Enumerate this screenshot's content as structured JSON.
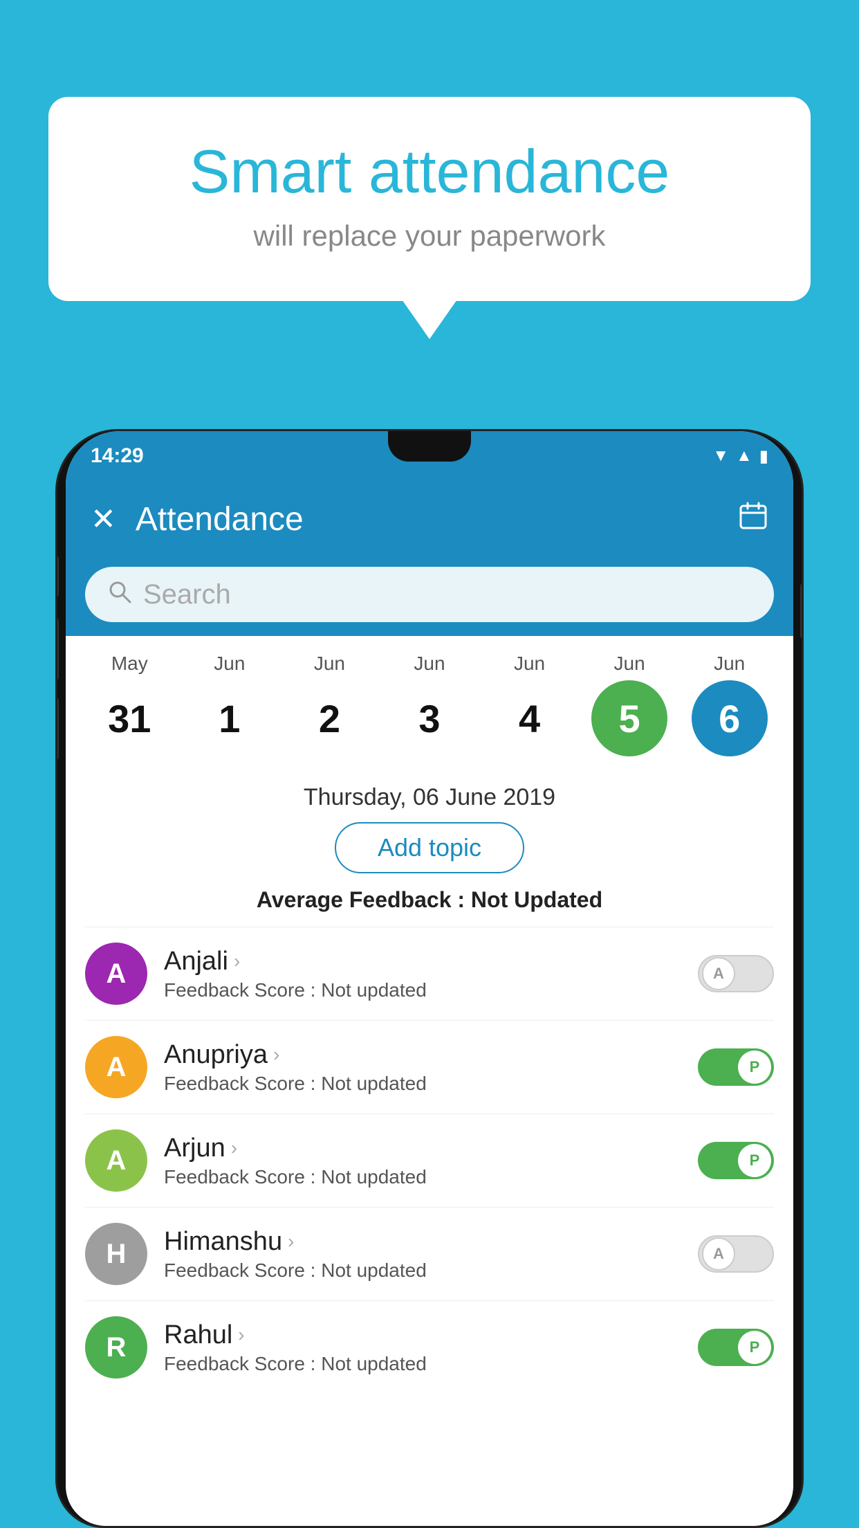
{
  "page": {
    "background_color": "#29B6D8"
  },
  "bubble": {
    "title": "Smart attendance",
    "subtitle": "will replace your paperwork"
  },
  "status_bar": {
    "time": "14:29"
  },
  "app_bar": {
    "title": "Attendance",
    "close_label": "✕",
    "calendar_label": "📅"
  },
  "search": {
    "placeholder": "Search"
  },
  "calendar": {
    "dates": [
      {
        "month": "May",
        "day": "31",
        "style": "normal"
      },
      {
        "month": "Jun",
        "day": "1",
        "style": "normal"
      },
      {
        "month": "Jun",
        "day": "2",
        "style": "normal"
      },
      {
        "month": "Jun",
        "day": "3",
        "style": "normal"
      },
      {
        "month": "Jun",
        "day": "4",
        "style": "normal"
      },
      {
        "month": "Jun",
        "day": "5",
        "style": "today"
      },
      {
        "month": "Jun",
        "day": "6",
        "style": "selected"
      }
    ],
    "selected_date": "Thursday, 06 June 2019"
  },
  "add_topic_label": "Add topic",
  "average_feedback_label": "Average Feedback :",
  "average_feedback_value": "Not Updated",
  "students": [
    {
      "name": "Anjali",
      "avatar_letter": "A",
      "avatar_color": "#9C27B0",
      "feedback_label": "Feedback Score :",
      "feedback_value": "Not updated",
      "toggle": "off",
      "toggle_letter": "A"
    },
    {
      "name": "Anupriya",
      "avatar_letter": "A",
      "avatar_color": "#F5A623",
      "feedback_label": "Feedback Score :",
      "feedback_value": "Not updated",
      "toggle": "on",
      "toggle_letter": "P"
    },
    {
      "name": "Arjun",
      "avatar_letter": "A",
      "avatar_color": "#8BC34A",
      "feedback_label": "Feedback Score :",
      "feedback_value": "Not updated",
      "toggle": "on",
      "toggle_letter": "P"
    },
    {
      "name": "Himanshu",
      "avatar_letter": "H",
      "avatar_color": "#9E9E9E",
      "feedback_label": "Feedback Score :",
      "feedback_value": "Not updated",
      "toggle": "off",
      "toggle_letter": "A"
    },
    {
      "name": "Rahul",
      "avatar_letter": "R",
      "avatar_color": "#4CAF50",
      "feedback_label": "Feedback Score :",
      "feedback_value": "Not updated",
      "toggle": "on",
      "toggle_letter": "P"
    }
  ]
}
